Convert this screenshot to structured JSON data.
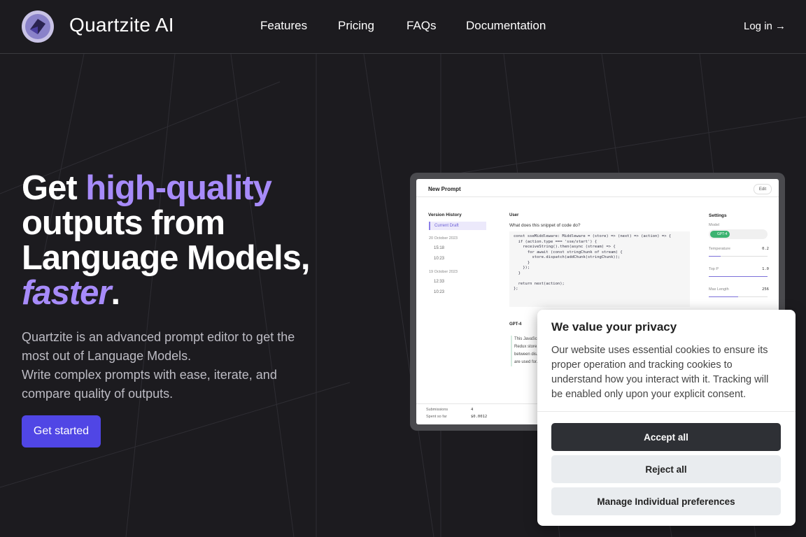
{
  "header": {
    "brand": "Quartzite AI",
    "nav": [
      "Features",
      "Pricing",
      "FAQs",
      "Documentation"
    ],
    "login": "Log in →"
  },
  "hero": {
    "title_pre": "Get ",
    "title_highlight": "high-quality",
    "title_mid": "outputs from Language Models,",
    "title_faster": "faster",
    "title_end": ".",
    "description_1": "Quartzite is an advanced prompt editor to get the most out of Language Models.",
    "description_2": "Write complex prompts with ease, iterate, and compare quality of outputs.",
    "cta": "Get started"
  },
  "mockup": {
    "title": "New Prompt",
    "edit": "Edit",
    "version_history": "Version History",
    "current_draft": "Current Draft",
    "date_1": "20 October 2023",
    "times_1": [
      "15:18",
      "10:23"
    ],
    "date_2": "19 October 2023",
    "times_2": [
      "12:33",
      "10:23"
    ],
    "user_label": "User",
    "question": "What does this snippet of code do?",
    "code": "const sseMiddleware: Middleware = (store) => (next) => (action) => {\n  if (action.type === 'sse/start') {\n    receiveString().then(async (stream) => {\n      for await (const stringChunk of stream) {\n        store.dispatch(addChunk(stringChunk));\n      }\n    });\n  }\n\n  return next(action);\n};",
    "gpt_label": "GPT-4",
    "gpt_text": "This JavaSc... Redux store... between dis... are used for...",
    "settings": "Settings",
    "model_label": "Model",
    "model_value": "GPT-4",
    "temperature_label": "Temperature",
    "temperature_value": "0.2",
    "top_p_label": "Top P",
    "top_p_value": "1.0",
    "max_length_label": "Max Length",
    "max_length_value": "256",
    "submissions_label": "Submissions",
    "submissions_value": "4",
    "spent_label": "Spent so far",
    "spent_value": "$0.0012"
  },
  "cookie": {
    "title": "We value your privacy",
    "body": "Our website uses essential cookies to ensure its proper operation and tracking cookies to understand how you interact with it. Tracking will be enabled only upon your explicit consent.",
    "accept": "Accept all",
    "reject": "Reject all",
    "manage": "Manage Individual preferences"
  },
  "colors": {
    "background": "#1c1b1f",
    "accent": "#a78bfa",
    "cta": "#5046e5"
  }
}
